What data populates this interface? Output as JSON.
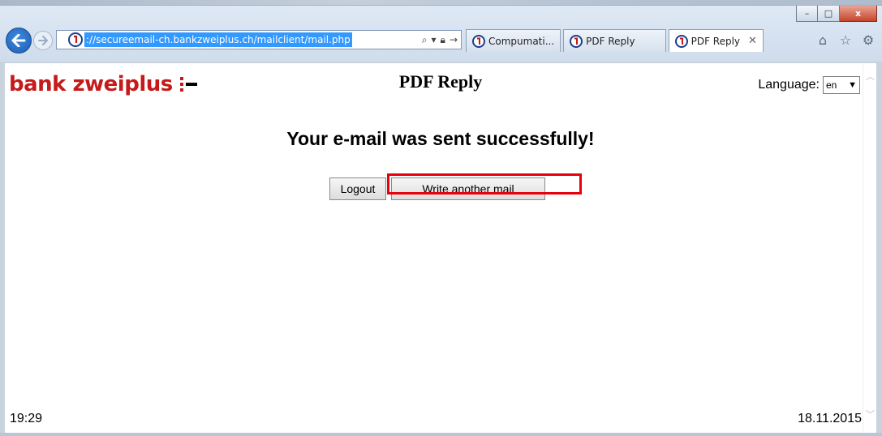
{
  "browser": {
    "url": "://secureemail-ch.bankzweiplus.ch/mailclient/mail.php",
    "tabs": [
      {
        "label": "Compumati...",
        "active": false
      },
      {
        "label": "PDF Reply",
        "active": false
      },
      {
        "label": "PDF Reply",
        "active": true
      }
    ],
    "window_controls": {
      "minimize": "–",
      "maximize": "□",
      "close": "x"
    }
  },
  "page": {
    "logo": "bank zweiplus",
    "title": "PDF Reply",
    "language_label": "Language:",
    "language_value": "en",
    "success_message": "Your e-mail was sent successfully!",
    "logout_label": "Logout",
    "write_label": "Write another mail",
    "time": "19:29",
    "date": "18.11.2015"
  },
  "colors": {
    "brand": "#c61a1a",
    "highlight": "#e8000b",
    "address_selection": "#3399ff"
  }
}
